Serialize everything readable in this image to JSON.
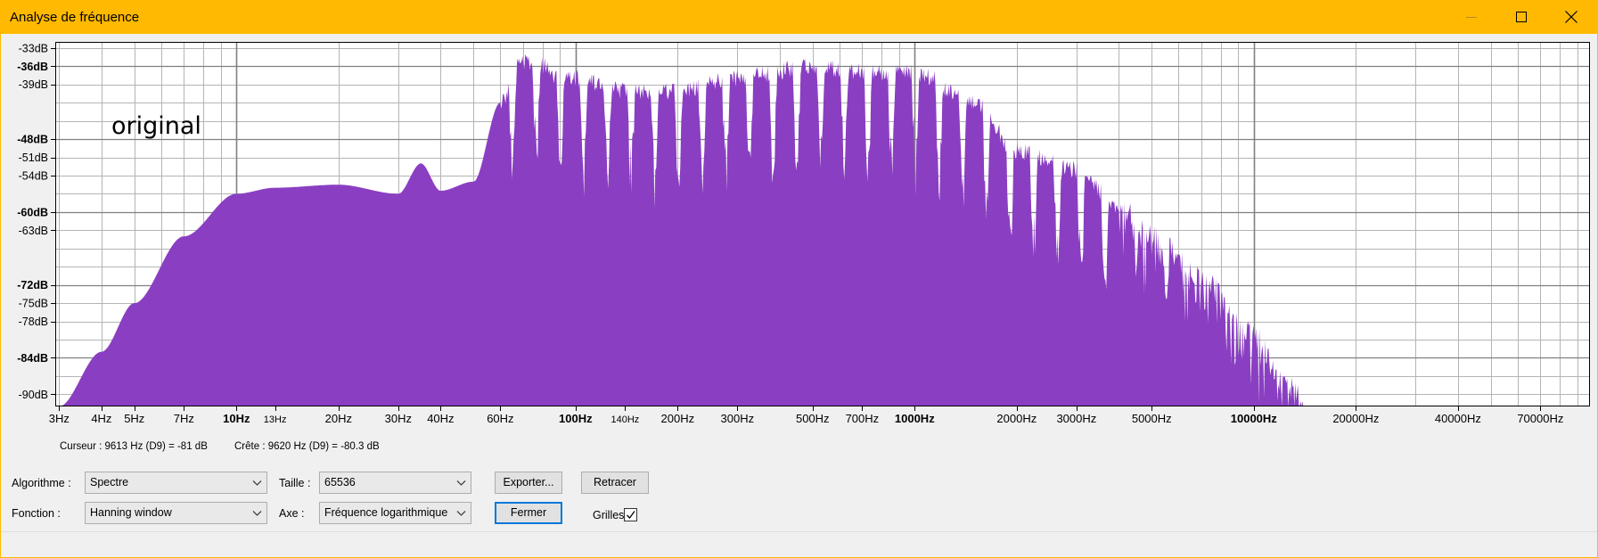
{
  "window": {
    "title": "Analyse de fréquence",
    "controls": [
      "minimize-icon",
      "maximize-icon",
      "close-icon"
    ],
    "accent_color": "#ffb900"
  },
  "plot": {
    "overlay_label": "original",
    "fill_color": "#8a3fc2",
    "grid": true,
    "x_axis_scale": "log",
    "y_tick_labels": [
      "-33dB",
      "-36dB",
      "-39dB",
      "-48dB",
      "-51dB",
      "-54dB",
      "-60dB",
      "-63dB",
      "-72dB",
      "-75dB",
      "-78dB",
      "-84dB",
      "-90dB"
    ],
    "y_bold_labels": [
      "-36dB",
      "-48dB",
      "-60dB",
      "-72dB",
      "-84dB"
    ],
    "x_tick_labels": [
      "3Hz",
      "4Hz",
      "5Hz",
      "7Hz",
      "10Hz",
      "13Hz",
      "20Hz",
      "30Hz",
      "40Hz",
      "60Hz",
      "100Hz",
      "140Hz",
      "200Hz",
      "300Hz",
      "500Hz",
      "700Hz",
      "1000Hz",
      "2000Hz",
      "3000Hz",
      "5000Hz",
      "10000Hz",
      "20000Hz",
      "40000Hz",
      "70000Hz"
    ],
    "x_bold_labels": [
      "10Hz",
      "100Hz",
      "1000Hz",
      "10000Hz"
    ]
  },
  "status": {
    "cursor": "Curseur : 9613 Hz (D9) = -81 dB",
    "peak": "Crête : 9620 Hz (D9) = -80.3 dB"
  },
  "controls": {
    "algorithm_label": "Algorithme :",
    "algorithm_value": "Spectre",
    "size_label": "Taille :",
    "size_value": "65536",
    "export_button": "Exporter...",
    "redraw_button": "Retracer",
    "function_label": "Fonction :",
    "function_value": "Hanning window",
    "axis_label": "Axe :",
    "axis_value": "Fréquence logarithmique",
    "close_button": "Fermer",
    "grids_label": "Grilles",
    "grids_checked": true
  },
  "chart_data": {
    "type": "area",
    "xlabel": "",
    "ylabel": "",
    "x_scale": "log",
    "xlim": [
      2.7,
      100000
    ],
    "ylim": [
      -92,
      -32
    ],
    "x": [
      3,
      4,
      5,
      7,
      10,
      13,
      20,
      30,
      35,
      40,
      50,
      60,
      70,
      80,
      90,
      100,
      140,
      200,
      300,
      500,
      700,
      1000,
      1500,
      2000,
      3000,
      4000,
      5000,
      7000,
      10000,
      12000,
      14000
    ],
    "series": [
      {
        "values": [
          -92,
          -83,
          -75,
          -64,
          -57,
          -56,
          -55.5,
          -57,
          -52,
          -56.5,
          -55,
          -42,
          -35,
          -36,
          -38,
          -38,
          -40,
          -40,
          -38,
          -36,
          -37,
          -37,
          -42,
          -50,
          -53,
          -59,
          -64,
          -71,
          -80,
          -87,
          -91
        ]
      }
    ]
  }
}
